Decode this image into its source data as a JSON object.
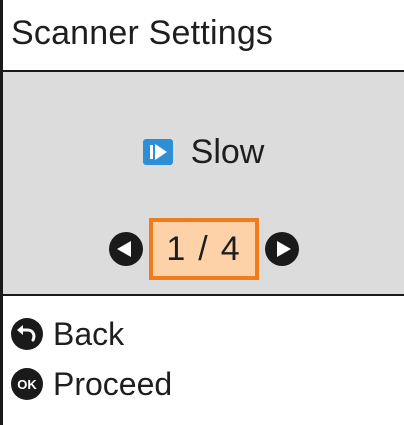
{
  "header": {
    "title": "Scanner Settings"
  },
  "setting": {
    "icon": "slow-mode-icon",
    "value": "Slow"
  },
  "pager": {
    "current": "1",
    "separator": "/",
    "total": "4"
  },
  "footer": {
    "back_label": "Back",
    "proceed_label": "Proceed",
    "ok_glyph": "OK"
  },
  "colors": {
    "accent_orange": "#f07d19",
    "highlight_fill": "#fdd2a8",
    "icon_blue": "#2f8fd6",
    "panel_gray": "#dcdcdc"
  }
}
